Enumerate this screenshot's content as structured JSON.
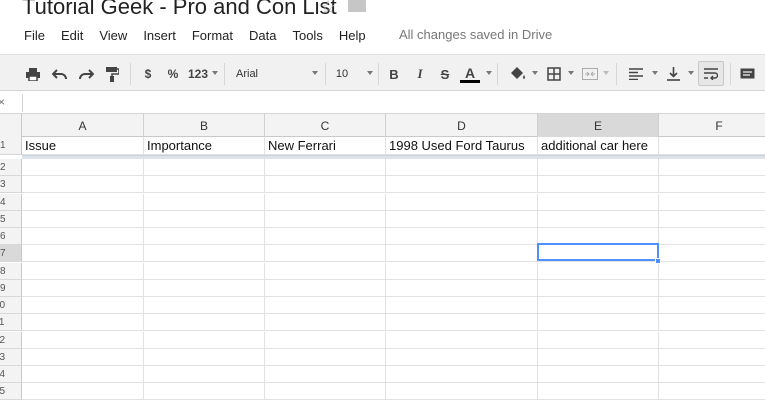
{
  "title": "Tutorial Geek - Pro and Con List",
  "menu": [
    "File",
    "Edit",
    "View",
    "Insert",
    "Format",
    "Data",
    "Tools",
    "Help"
  ],
  "save_status": "All changes saved in Drive",
  "toolbar": {
    "currency_label": "$",
    "percent_label": "%",
    "number_format_label": "123",
    "font_name": "Arial",
    "font_size": "10",
    "bold_label": "B",
    "italic_label": "I",
    "strikethrough_label": "S",
    "text_color_label": "A",
    "text_color": "#000000"
  },
  "columns": [
    "A",
    "B",
    "C",
    "D",
    "E",
    "F"
  ],
  "selected_column": "E",
  "selected_row": "7",
  "rows": [
    {
      "num": "1",
      "cells": [
        "Issue",
        "Importance",
        "New Ferrari",
        "1998 Used Ford Taurus",
        "additional car here",
        ""
      ]
    },
    {
      "num": "2",
      "cells": [
        "",
        "",
        "",
        "",
        "",
        ""
      ]
    },
    {
      "num": "3",
      "cells": [
        "",
        "",
        "",
        "",
        "",
        ""
      ]
    },
    {
      "num": "4",
      "cells": [
        "",
        "",
        "",
        "",
        "",
        ""
      ]
    },
    {
      "num": "5",
      "cells": [
        "",
        "",
        "",
        "",
        "",
        ""
      ]
    },
    {
      "num": "6",
      "cells": [
        "",
        "",
        "",
        "",
        "",
        ""
      ]
    },
    {
      "num": "7",
      "cells": [
        "",
        "",
        "",
        "",
        "",
        ""
      ]
    },
    {
      "num": "8",
      "cells": [
        "",
        "",
        "",
        "",
        "",
        ""
      ]
    },
    {
      "num": "9",
      "cells": [
        "",
        "",
        "",
        "",
        "",
        ""
      ]
    },
    {
      "num": "10",
      "cells": [
        "",
        "",
        "",
        "",
        "",
        ""
      ]
    },
    {
      "num": "11",
      "cells": [
        "",
        "",
        "",
        "",
        "",
        ""
      ]
    },
    {
      "num": "12",
      "cells": [
        "",
        "",
        "",
        "",
        "",
        ""
      ]
    },
    {
      "num": "13",
      "cells": [
        "",
        "",
        "",
        "",
        "",
        ""
      ]
    },
    {
      "num": "14",
      "cells": [
        "",
        "",
        "",
        "",
        "",
        ""
      ]
    },
    {
      "num": "15",
      "cells": [
        "",
        "",
        "",
        "",
        "",
        ""
      ]
    }
  ],
  "colors": {
    "selection": "#4d90fe",
    "header_bg": "#f3f3f3",
    "toolbar_bg": "#f1f1f1"
  }
}
